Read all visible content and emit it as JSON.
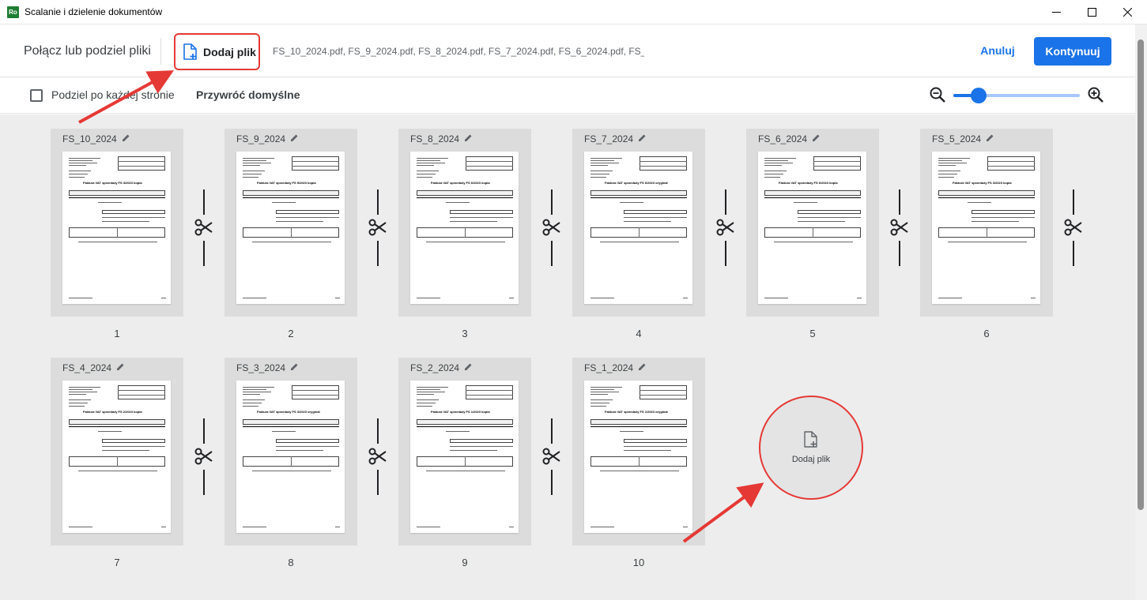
{
  "window": {
    "title": "Scalanie i dzielenie dokumentów",
    "app_badge": "Ro"
  },
  "header": {
    "title": "Połącz lub podziel pliki",
    "add_file_label": "Dodaj plik",
    "files_summary": "FS_10_2024.pdf, FS_9_2024.pdf, FS_8_2024.pdf, FS_7_2024.pdf, FS_6_2024.pdf, FS_...",
    "cancel_label": "Anuluj",
    "continue_label": "Kontynuuj"
  },
  "options": {
    "split_each_page_label": "Podziel po każdej stronie",
    "split_each_page_checked": false,
    "reset_label": "Przywróć domyślne",
    "zoom_level": 0.2
  },
  "documents": [
    {
      "name": "FS_10_2024",
      "page": "1",
      "doc_title": "Faktura VAT sprzedaży FS 3/2023 kopia"
    },
    {
      "name": "FS_9_2024",
      "page": "2",
      "doc_title": "Faktura VAT sprzedaży FS 5/2023 kopia"
    },
    {
      "name": "FS_8_2024",
      "page": "3",
      "doc_title": "Faktura VAT sprzedaży FS 6/2023 kopia"
    },
    {
      "name": "FS_7_2024",
      "page": "4",
      "doc_title": "Faktura VAT sprzedaży FS 6/2023 oryginał"
    },
    {
      "name": "FS_6_2024",
      "page": "5",
      "doc_title": "Faktura VAT sprzedaży FS 6/2023 kopia"
    },
    {
      "name": "FS_5_2024",
      "page": "6",
      "doc_title": "Faktura VAT sprzedaży FS 3/2023 kopia"
    },
    {
      "name": "FS_4_2024",
      "page": "7",
      "doc_title": "Faktura VAT sprzedaży FS 2/2023 kopia"
    },
    {
      "name": "FS_3_2024",
      "page": "8",
      "doc_title": "Faktura VAT sprzedaży FS 3/2023 oryginał"
    },
    {
      "name": "FS_2_2024",
      "page": "9",
      "doc_title": "Faktura VAT sprzedaży FS 1/2023 kopia"
    },
    {
      "name": "FS_1_2024",
      "page": "10",
      "doc_title": "Faktura VAT sprzedaży FS 1/2023 oryginał"
    }
  ],
  "add_tile": {
    "label": "Dodaj plik"
  },
  "colors": {
    "accent": "#1a73e8",
    "highlight": "#e53935"
  }
}
